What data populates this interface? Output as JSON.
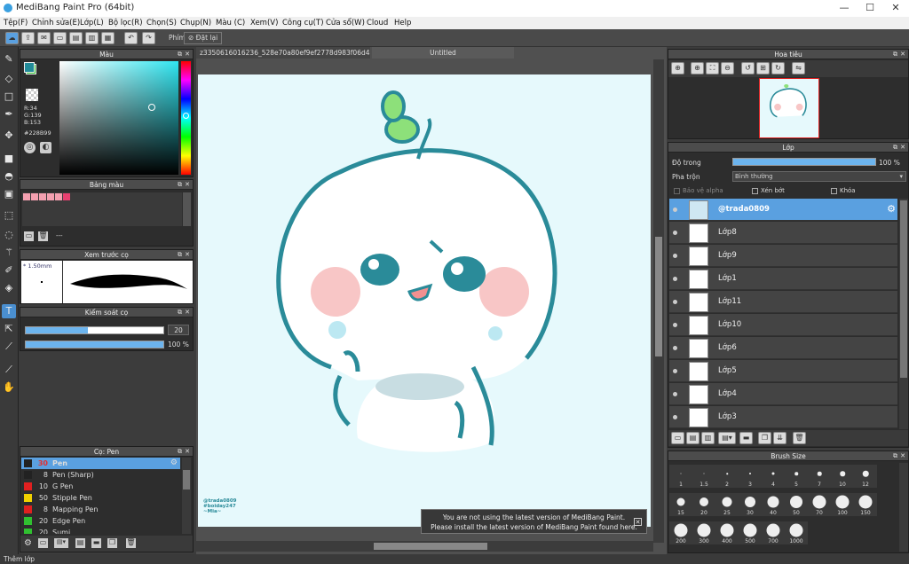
{
  "window": {
    "title": "MediBang Paint Pro (64bit)"
  },
  "menu": [
    "Tệp(F)",
    "Chỉnh sửa(E)",
    "Lớp(L)",
    "Bộ lọc(R)",
    "Chọn(S)",
    "Chụp(N)",
    "Màu (C)",
    "Xem(V)",
    "Công cụ(T)",
    "Cửa sổ(W)",
    "Cloud",
    "Help"
  ],
  "toolbar": {
    "brush_label": "Phím",
    "reset_label": "Đặt lại"
  },
  "color_panel": {
    "title": "Màu",
    "r": "R:34",
    "g": "G:139",
    "b": "B:153",
    "hex": "#228B99",
    "fg": "#228B99",
    "bg": "#2fbf2f"
  },
  "palette_panel": {
    "title": "Bảng màu",
    "dash": "---"
  },
  "brush_preview": {
    "title": "Xem trước cọ",
    "size": "1.50mm"
  },
  "brush_control": {
    "title": "Kiểm soát cọ",
    "size_value": "20",
    "opacity_value": "100 %",
    "size_fraction": 0.45,
    "opacity_fraction": 1.0
  },
  "brush_list": {
    "title": "Cọ: Pen",
    "items": [
      {
        "color": "#222222",
        "size": "30",
        "name": "Pen",
        "selected": true
      },
      {
        "color": "#222222",
        "size": "8",
        "name": "Pen (Sharp)"
      },
      {
        "color": "#e02020",
        "size": "10",
        "name": "G Pen"
      },
      {
        "color": "#f0d000",
        "size": "50",
        "name": "Stipple Pen"
      },
      {
        "color": "#e02020",
        "size": "8",
        "name": "Mapping Pen"
      },
      {
        "color": "#30c030",
        "size": "20",
        "name": "Edge Pen"
      },
      {
        "color": "#30c030",
        "size": "20",
        "name": "Sumi"
      }
    ]
  },
  "documents": {
    "tab1": "z3350616016236_528e70a80ef9ef2778d983f06d489e64.jpg",
    "tab2": "Untitled"
  },
  "canvas": {
    "watermark_l1": "@trada0809",
    "watermark_l2": "#boiday247",
    "watermark_l3": "~Mia~"
  },
  "notice": {
    "line1": "You are not using the latest version of MediBang Paint.",
    "line2": "Please install the latest version of MediBang Paint found here."
  },
  "navigator": {
    "title": "Hoa tiêu"
  },
  "layers": {
    "title": "Lớp",
    "opacity_label": "Độ trong",
    "opacity_value": "100 %",
    "opacity_fraction": 1.0,
    "blend_label": "Pha trộn",
    "blend_value": "Bình thường",
    "protect_alpha": "Bảo vệ alpha",
    "clip": "Xén bớt",
    "lock": "Khóa",
    "items": [
      "@trada0809",
      "Lớp8",
      "Lớp9",
      "Lớp1",
      "Lớp11",
      "Lớp10",
      "Lớp6",
      "Lớp5",
      "Lớp4",
      "Lớp3"
    ]
  },
  "brush_size": {
    "title": "Brush Size",
    "row1": [
      "1",
      "1.5",
      "2",
      "3",
      "4",
      "5",
      "7",
      "10",
      "12"
    ],
    "row2": [
      "15",
      "20",
      "25",
      "30",
      "40",
      "50",
      "70",
      "100",
      "150"
    ],
    "row3": [
      "200",
      "300",
      "400",
      "500",
      "700",
      "1000"
    ]
  },
  "status": {
    "text": "Thêm lớp"
  }
}
